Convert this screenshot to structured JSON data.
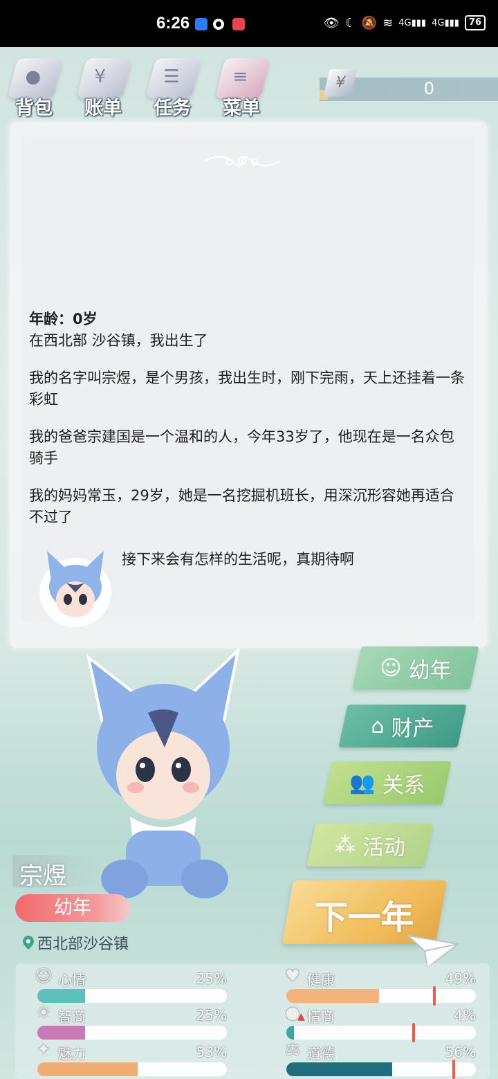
{
  "status_bar": {
    "time": "6:26",
    "network": "4G",
    "battery": "76"
  },
  "toolbar": {
    "items": [
      {
        "label": "背包",
        "icon": "backpack-icon"
      },
      {
        "label": "账单",
        "icon": "bill-icon"
      },
      {
        "label": "任务",
        "icon": "task-icon"
      },
      {
        "label": "菜单",
        "icon": "menu-icon"
      }
    ],
    "currency_symbol": "¥",
    "money": "0"
  },
  "story": {
    "age_line": "年龄：0岁",
    "lines": [
      "在西北部 沙谷镇，我出生了",
      "我的名字叫宗煜，是个男孩，我出生时，刚下完雨，天上还挂着一条彩虹",
      "我的爸爸宗建国是一个温和的人，今年33岁了，他现在是一名众包骑手",
      "我的妈妈常玉，29岁，她是一名挖掘机班长，用深沉形容她再适合不过了"
    ],
    "closing": "接下来会有怎样的生活呢，真期待啊"
  },
  "menu_buttons": [
    {
      "label": "幼年",
      "icon": "baby-icon",
      "color": "#8ccaa2"
    },
    {
      "label": "财产",
      "icon": "house-icon",
      "color": "#4fae97"
    },
    {
      "label": "关系",
      "icon": "people-icon",
      "color": "#a9d27c"
    },
    {
      "label": "活动",
      "icon": "activity-icon",
      "color": "#bada8a"
    }
  ],
  "next_year_label": "下一年",
  "character": {
    "name": "宗煜",
    "stage": "幼年",
    "location": "西北部沙谷镇"
  },
  "stats": [
    {
      "label": "心情",
      "value": 25,
      "pct_text": "25%",
      "icon": "smile-icon",
      "color": "#5cc1bb"
    },
    {
      "label": "健康",
      "value": 49,
      "pct_text": "49%",
      "icon": "heart-icon",
      "color": "#f4b37c"
    },
    {
      "label": "智商",
      "value": 25,
      "pct_text": "25%",
      "icon": "bulb-icon",
      "color": "#c87ab7"
    },
    {
      "label": "情商",
      "value": 4,
      "pct_text": "4%",
      "icon": "apple-icon",
      "color": "#3aa7a4"
    },
    {
      "label": "魅力",
      "value": 53,
      "pct_text": "53%",
      "icon": "sparkle-icon",
      "color": "#f2ad72"
    },
    {
      "label": "道德",
      "value": 56,
      "pct_text": "56%",
      "icon": "scale-icon",
      "color": "#1f6e7c"
    }
  ]
}
